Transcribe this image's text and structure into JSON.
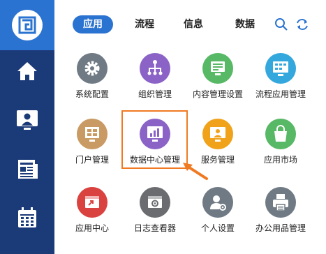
{
  "tabs": [
    {
      "label": "应用"
    },
    {
      "label": "流程"
    },
    {
      "label": "信息"
    },
    {
      "label": "数据"
    }
  ],
  "active_tab": "应用",
  "sidebar_icons": [
    "logo-icon",
    "home-icon",
    "monitor-user-icon",
    "news-icon",
    "calendar-icon"
  ],
  "apps": [
    {
      "label": "系统配置",
      "icon": "gear-icon",
      "color": "#6f7a84"
    },
    {
      "label": "组织管理",
      "icon": "org-chart-icon",
      "color": "#8b63c7"
    },
    {
      "label": "内容管理设置",
      "icon": "content-icon",
      "color": "#57b865"
    },
    {
      "label": "流程应用管理",
      "icon": "workflow-app-icon",
      "color": "#34a7dd"
    },
    {
      "label": "门户管理",
      "icon": "portal-icon",
      "color": "#c99a63"
    },
    {
      "label": "数据中心管理",
      "icon": "bar-chart-icon",
      "color": "#8b63c7"
    },
    {
      "label": "服务管理",
      "icon": "service-icon",
      "color": "#f0a21a"
    },
    {
      "label": "应用市场",
      "icon": "shopping-bag-icon",
      "color": "#57b865"
    },
    {
      "label": "应用中心",
      "icon": "app-center-icon",
      "color": "#d9423f"
    },
    {
      "label": "日志查看器",
      "icon": "log-viewer-icon",
      "color": "#6a6c70"
    },
    {
      "label": "个人设置",
      "icon": "user-settings-icon",
      "color": "#6f7a84"
    },
    {
      "label": "办公用品管理",
      "icon": "printer-icon",
      "color": "#6f7a84"
    }
  ],
  "colors": {
    "sidebar": "#1b3a78",
    "sidebar_top": "#2b73d0",
    "accent": "#2b73d0",
    "highlight": "#f07a22"
  }
}
